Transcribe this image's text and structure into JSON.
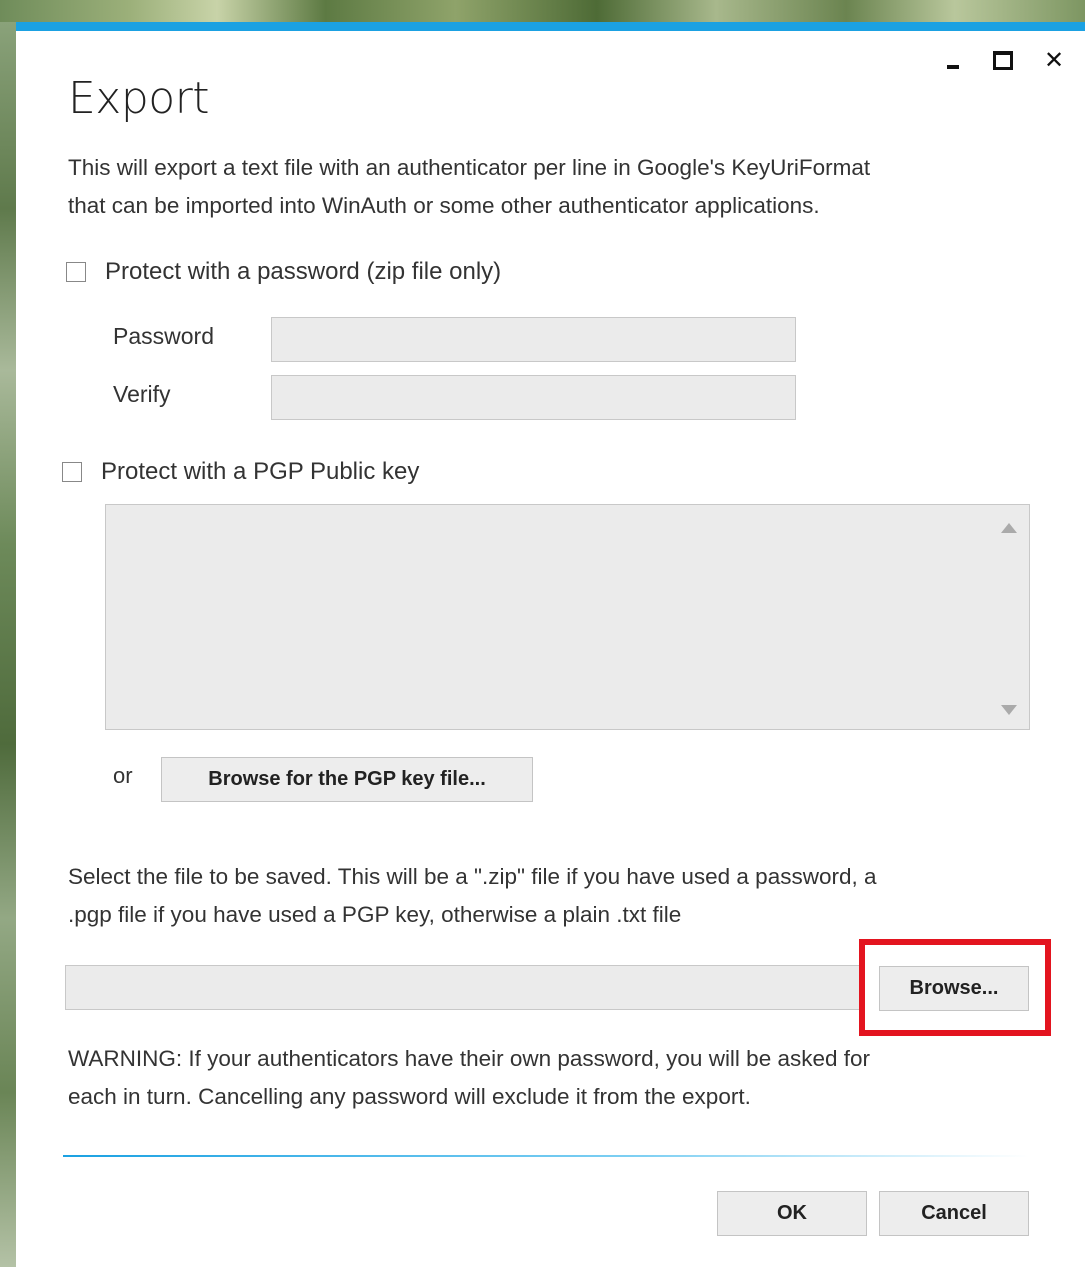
{
  "window": {
    "title": "Export",
    "accent_color": "#1ba1e2",
    "controls": {
      "minimize": "minimize-icon",
      "maximize": "maximize-icon",
      "close": "close-icon"
    }
  },
  "intro": {
    "line1": "This will export a text file with an authenticator per line in Google's KeyUriFormat",
    "line2": "that can be imported into WinAuth or some other authenticator applications."
  },
  "password_section": {
    "checkbox_label": "Protect with a password (zip file only)",
    "checked": false,
    "password_label": "Password",
    "password_value": "",
    "verify_label": "Verify",
    "verify_value": ""
  },
  "pgp_section": {
    "checkbox_label": "Protect with a PGP Public key",
    "checked": false,
    "key_text": "",
    "or_label": "or",
    "browse_key_label": "Browse for the PGP key file..."
  },
  "file_section": {
    "line1": "Select the file to be saved. This will be a \".zip\" file if you have used a password, a",
    "line2": ".pgp file if you have used a PGP key, otherwise a plain .txt file",
    "file_path": "",
    "browse_label": "Browse...",
    "highlight_color": "#e3141f"
  },
  "warning": {
    "line1": "WARNING: If your authenticators have their own password, you will be asked for",
    "line2": "each in turn. Cancelling any password will exclude it from the export."
  },
  "footer": {
    "ok_label": "OK",
    "cancel_label": "Cancel"
  }
}
